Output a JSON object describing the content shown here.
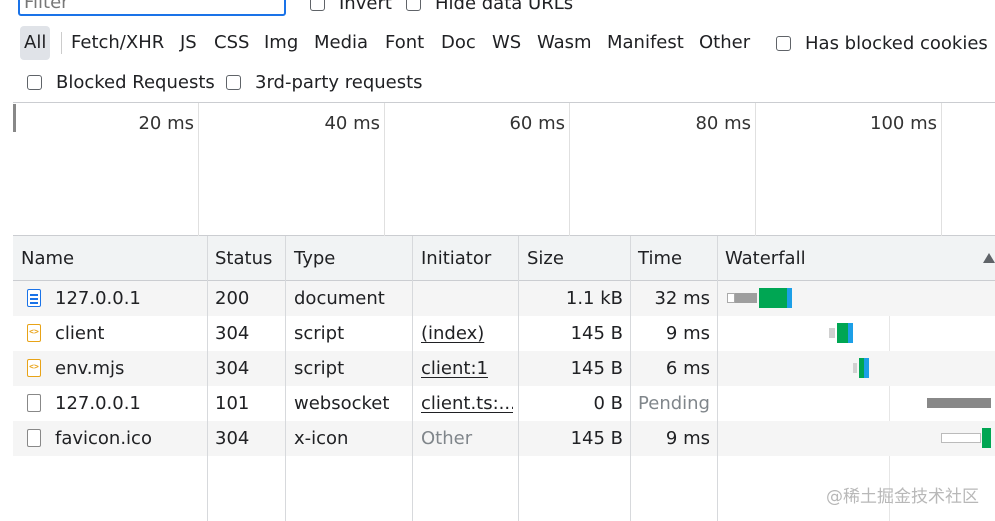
{
  "filter": {
    "placeholder": "Filter",
    "invert_label": "Invert",
    "hide_data_urls_label": "Hide data URLs"
  },
  "type_filters": [
    "All",
    "Fetch/XHR",
    "JS",
    "CSS",
    "Img",
    "Media",
    "Font",
    "Doc",
    "WS",
    "Wasm",
    "Manifest",
    "Other"
  ],
  "active_type": "All",
  "has_blocked_cookies_label": "Has blocked cookies",
  "blocked_requests_label": "Blocked Requests",
  "third_party_label": "3rd-party requests",
  "overview_ticks": [
    "20 ms",
    "40 ms",
    "60 ms",
    "80 ms",
    "100 ms"
  ],
  "columns": {
    "name": "Name",
    "status": "Status",
    "type": "Type",
    "initiator": "Initiator",
    "size": "Size",
    "time": "Time",
    "waterfall": "Waterfall"
  },
  "rows": [
    {
      "name": "127.0.0.1",
      "status": "200",
      "type": "document",
      "initiator": "",
      "size": "1.1 kB",
      "time": "32 ms",
      "icon": "document-icon"
    },
    {
      "name": "client",
      "status": "304",
      "type": "script",
      "initiator": "(index)",
      "size": "145 B",
      "time": "9 ms",
      "icon": "script-icon"
    },
    {
      "name": "env.mjs",
      "status": "304",
      "type": "script",
      "initiator": "client:1",
      "size": "145 B",
      "time": "6 ms",
      "icon": "script-icon"
    },
    {
      "name": "127.0.0.1",
      "status": "101",
      "type": "websocket",
      "initiator": "client.ts:...",
      "size": "0 B",
      "time": "Pending",
      "icon": "blank-file-icon"
    },
    {
      "name": "favicon.ico",
      "status": "304",
      "type": "x-icon",
      "initiator": "Other",
      "size": "145 B",
      "time": "9 ms",
      "icon": "blank-file-icon"
    }
  ],
  "watermark": "@稀土掘金技术社区",
  "colors": {
    "accent": "#1a73e8",
    "waterfall_waiting": "#00a653",
    "waterfall_download": "#1c9fe7",
    "waterfall_queue": "#9e9e9e",
    "script_icon": "#e8a317"
  }
}
